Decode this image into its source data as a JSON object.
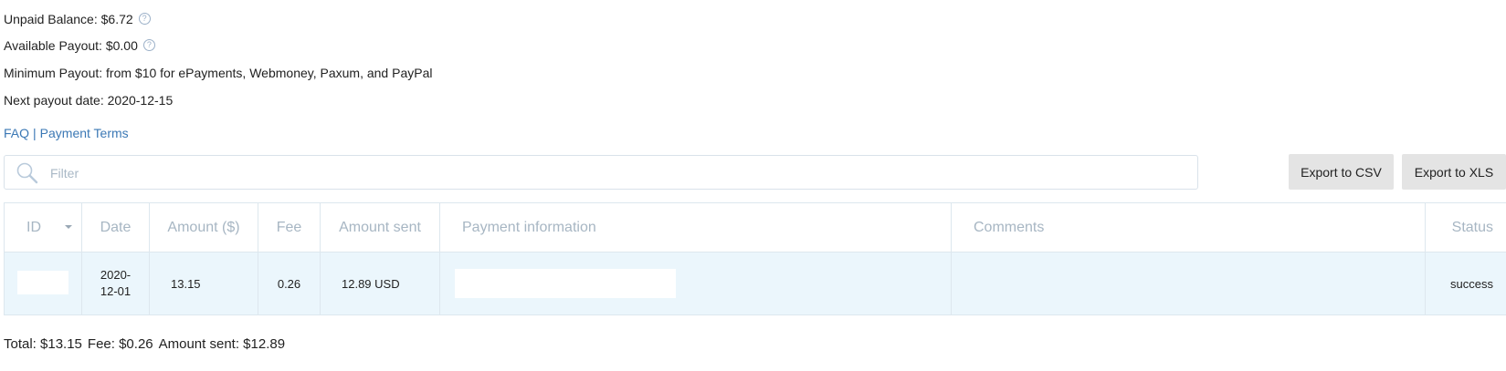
{
  "balance": {
    "unpaid": "Unpaid Balance: $6.72",
    "available": "Available Payout: $0.00",
    "minimum": "Minimum Payout: from $10 for ePayments, Webmoney, Paxum, and PayPal",
    "next_date": "Next payout date: 2020-12-15",
    "help_glyph": "?"
  },
  "links": {
    "faq": "FAQ",
    "sep": "|",
    "terms": "Payment Terms"
  },
  "filter": {
    "placeholder": "Filter"
  },
  "buttons": {
    "csv": "Export to CSV",
    "xls": "Export to XLS"
  },
  "table": {
    "headers": [
      "ID",
      "Date",
      "Amount ($)",
      "Fee",
      "Amount sent",
      "Payment information",
      "Comments",
      "Status"
    ],
    "rows": [
      {
        "id": "",
        "date_line1": "2020-",
        "date_line2": "12-01",
        "amount": "13.15",
        "fee": "0.26",
        "amount_sent": "12.89 USD",
        "payment_info": "",
        "comments": "",
        "status": "success"
      }
    ]
  },
  "totals": {
    "total": "Total: $13.15",
    "fee": "Fee: $0.26",
    "sent": "Amount sent: $12.89"
  },
  "colors": {
    "link": "#3b78b5",
    "row_bg": "#ebf6fc",
    "button_bg": "#e4e4e4",
    "header_text": "#a7b6c3"
  },
  "icons": {
    "help": "help-circle-icon",
    "search": "search-icon",
    "sort": "sort-desc-icon"
  }
}
